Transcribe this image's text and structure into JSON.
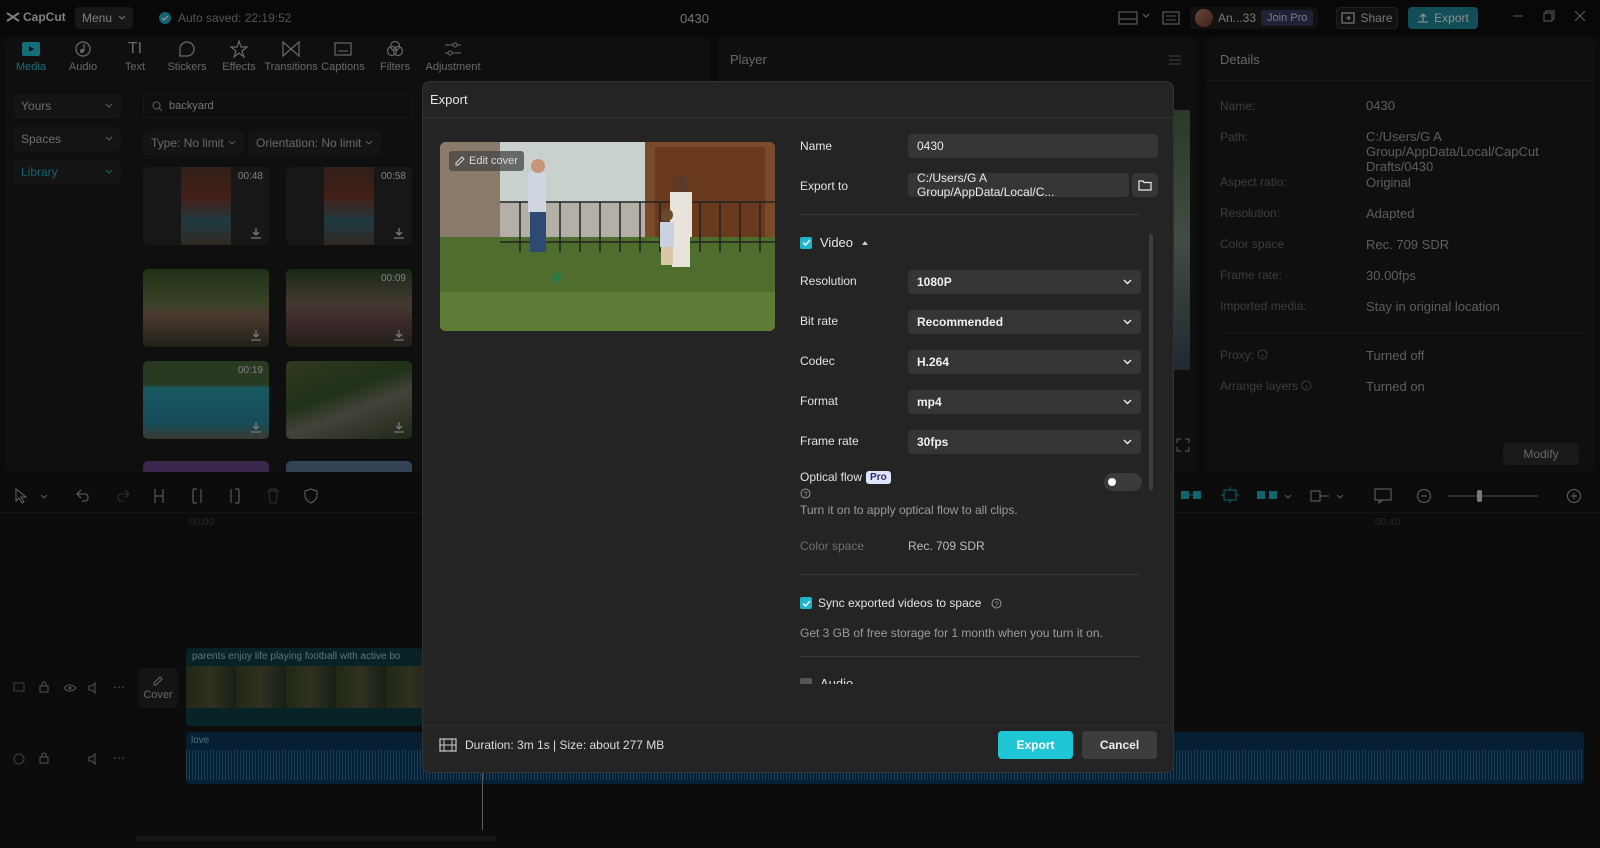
{
  "app": {
    "logo": "CapCut",
    "menu_label": "Menu",
    "autosave": "Auto saved: 22:19:52",
    "project_title": "0430",
    "user_name": "An...33",
    "join_pro": "Join Pro",
    "share_label": "Share",
    "export_label": "Export"
  },
  "toolbar": {
    "tools": [
      {
        "label": "Media",
        "icon": "media-icon",
        "active": true
      },
      {
        "label": "Audio",
        "icon": "audio-icon"
      },
      {
        "label": "Text",
        "icon": "text-icon"
      },
      {
        "label": "Stickers",
        "icon": "stickers-icon"
      },
      {
        "label": "Effects",
        "icon": "effects-icon"
      },
      {
        "label": "Transitions",
        "icon": "transitions-icon"
      },
      {
        "label": "Captions",
        "icon": "captions-icon"
      },
      {
        "label": "Filters",
        "icon": "filters-icon"
      },
      {
        "label": "Adjustment",
        "icon": "adjustment-icon"
      }
    ]
  },
  "sidebar": {
    "items": [
      {
        "label": "Yours"
      },
      {
        "label": "Spaces"
      },
      {
        "label": "Library",
        "active": true
      }
    ]
  },
  "media": {
    "search_value": "backyard",
    "filter_type": "Type: No limit",
    "filter_orientation": "Orientation: No limit",
    "thumbs": [
      {
        "duration": "00:48"
      },
      {
        "duration": "00:58"
      },
      {
        "duration": ""
      },
      {
        "duration": "00:09"
      },
      {
        "duration": "00:19"
      },
      {
        "duration": ""
      }
    ]
  },
  "player": {
    "title": "Player"
  },
  "details": {
    "title": "Details",
    "rows": [
      {
        "label": "Name:",
        "value": "0430"
      },
      {
        "label": "Path:",
        "value": "C:/Users/G A Group/AppData/Local/CapCut Drafts/0430"
      },
      {
        "label": "Aspect ratio:",
        "value": "Original"
      },
      {
        "label": "Resolution:",
        "value": "Adapted"
      },
      {
        "label": "Color space",
        "value": "Rec. 709 SDR"
      },
      {
        "label": "Frame rate:",
        "value": "30.00fps"
      },
      {
        "label": "Imported media:",
        "value": "Stay in original location"
      },
      {
        "label": "Proxy:",
        "value": "Turned off"
      },
      {
        "label": "Arrange layers",
        "value": "Turned on"
      }
    ],
    "modify_label": "Modify"
  },
  "timeline": {
    "ruler_start": "00:00",
    "ruler_end": "00:40",
    "video_clip_label": "parents enjoy life playing football with active bo",
    "audio_clip_label": "love",
    "cover_label": "Cover"
  },
  "export_dialog": {
    "title": "Export",
    "edit_cover": "Edit cover",
    "name_label": "Name",
    "name_value": "0430",
    "export_to_label": "Export to",
    "export_to_value": "C:/Users/G A Group/AppData/Local/C...",
    "video_section": "Video",
    "resolution_label": "Resolution",
    "resolution_value": "1080P",
    "bitrate_label": "Bit rate",
    "bitrate_value": "Recommended",
    "codec_label": "Codec",
    "codec_value": "H.264",
    "format_label": "Format",
    "format_value": "mp4",
    "framerate_label": "Frame rate",
    "framerate_value": "30fps",
    "optical_flow_label": "Optical flow",
    "pro_badge": "Pro",
    "optical_flow_hint": "Turn it on to apply optical flow to all clips.",
    "colorspace_label": "Color space",
    "colorspace_value": "Rec. 709 SDR",
    "sync_label": "Sync exported videos to space",
    "sync_hint": "Get 3 GB of free storage for 1 month when you turn it on.",
    "audio_section": "Audio",
    "footer_info": "Duration: 3m 1s | Size: about 277 MB",
    "export_button": "Export",
    "cancel_button": "Cancel"
  },
  "colors": {
    "accent": "#1fc6d6",
    "panel": "#1c1c1c",
    "dialog": "#242424"
  }
}
